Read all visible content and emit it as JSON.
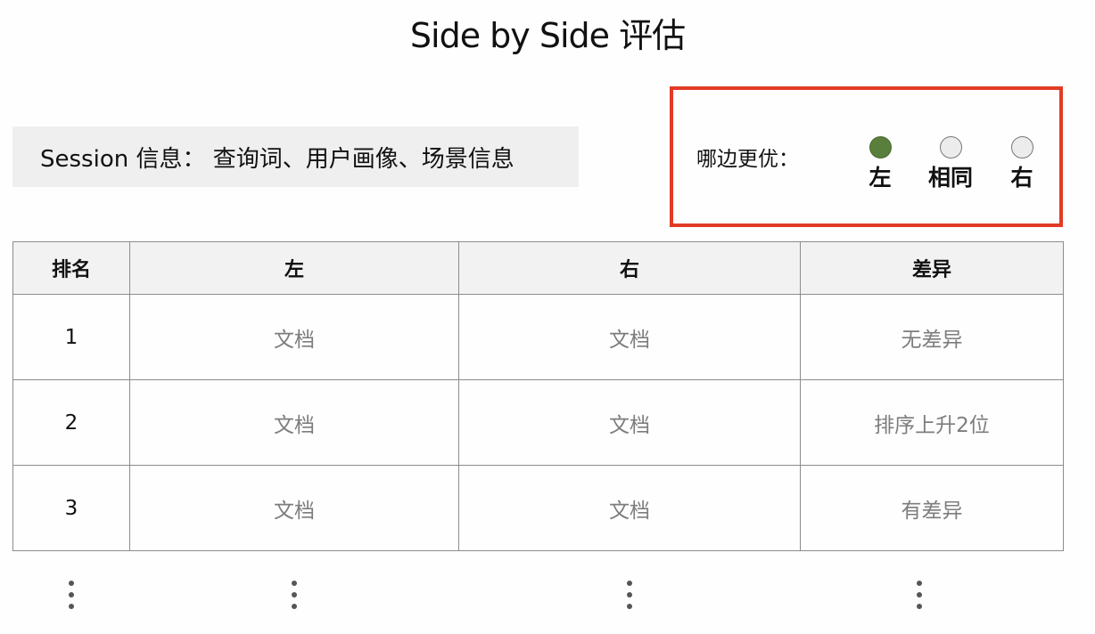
{
  "title": "Side by Side 评估",
  "session_info": "Session 信息：  查询词、用户画像、场景信息",
  "preference": {
    "label": "哪边更优：",
    "options": [
      {
        "label": "左",
        "selected": true
      },
      {
        "label": "相同",
        "selected": false
      },
      {
        "label": "右",
        "selected": false
      }
    ],
    "selected_color": "#5a7f3c",
    "border_color": "#e23b25"
  },
  "table": {
    "headers": [
      "排名",
      "左",
      "右",
      "差异"
    ],
    "rows": [
      {
        "rank": "1",
        "left": "文档",
        "right": "文档",
        "diff": "无差异"
      },
      {
        "rank": "2",
        "left": "文档",
        "right": "文档",
        "diff": "排序上升2位"
      },
      {
        "rank": "3",
        "left": "文档",
        "right": "文档",
        "diff": "有差异"
      }
    ]
  }
}
